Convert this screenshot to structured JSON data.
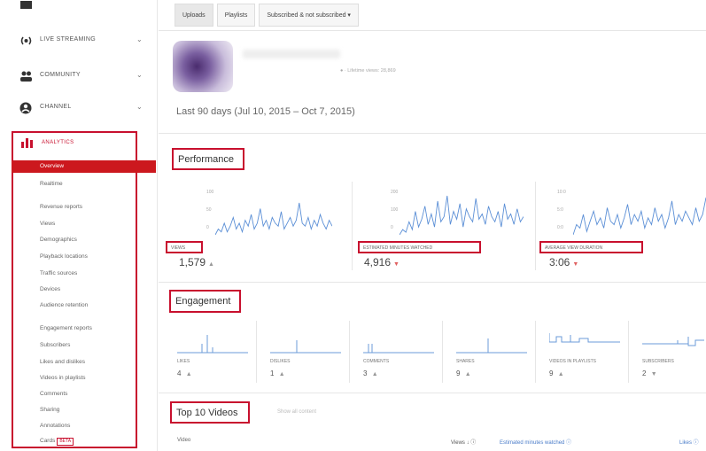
{
  "sidebar": {
    "sections": [
      {
        "label": "LIVE STREAMING",
        "icon": "live-stream-icon"
      },
      {
        "label": "COMMUNITY",
        "icon": "community-icon"
      },
      {
        "label": "CHANNEL",
        "icon": "channel-icon"
      }
    ],
    "analytics_label": "ANALYTICS",
    "analytics_icon": "bar-chart-icon",
    "overview": "Overview",
    "items": [
      "Realtime",
      "Revenue reports",
      "Views",
      "Demographics",
      "Playback locations",
      "Traffic sources",
      "Devices",
      "Audience retention",
      "Engagement reports",
      "Subscribers",
      "Likes and dislikes",
      "Videos in playlists",
      "Comments",
      "Sharing",
      "Annotations",
      "Cards"
    ],
    "beta_badge": "BETA",
    "accent": "#cc181e"
  },
  "tabs": [
    "Uploads",
    "Playlists",
    "Subscribed & not subscribed ▾"
  ],
  "channel": {
    "subtitle": "● · Lifetime views: 28,869"
  },
  "date_range": "Last 90 days (Jul 10, 2015 – Oct 7, 2015)",
  "performance": {
    "title": "Performance",
    "metrics": [
      {
        "label": "VIEWS",
        "value": "1,579",
        "trend": "▲",
        "trend_dir": "up",
        "axis": [
          "100",
          "50",
          "0"
        ],
        "series": [
          2,
          4,
          3,
          6,
          3,
          5,
          8,
          4,
          6,
          3,
          7,
          5,
          9,
          4,
          6,
          11,
          5,
          7,
          4,
          8,
          6,
          5,
          10,
          4,
          6,
          8,
          5,
          7,
          13,
          6,
          5,
          8,
          4,
          7,
          5,
          9,
          6,
          4,
          7,
          5
        ]
      },
      {
        "label": "ESTIMATED MINUTES WATCHED",
        "value": "4,916",
        "trend": "▼",
        "trend_dir": "down",
        "axis": [
          "200",
          "100",
          "0"
        ],
        "series": [
          3,
          5,
          4,
          8,
          5,
          12,
          6,
          9,
          14,
          7,
          11,
          6,
          16,
          8,
          10,
          18,
          7,
          12,
          9,
          15,
          6,
          13,
          10,
          8,
          17,
          9,
          11,
          7,
          14,
          10,
          8,
          12,
          6,
          15,
          9,
          11,
          7,
          13,
          8,
          10
        ]
      },
      {
        "label": "AVERAGE VIEW DURATION",
        "value": "3:06",
        "trend": "▼",
        "trend_dir": "down",
        "axis": [
          "10:0",
          "5:0",
          "0:0"
        ],
        "series": [
          3,
          6,
          5,
          9,
          4,
          7,
          10,
          6,
          8,
          5,
          11,
          7,
          6,
          9,
          5,
          8,
          12,
          6,
          9,
          7,
          10,
          5,
          8,
          6,
          11,
          7,
          9,
          5,
          8,
          13,
          6,
          9,
          7,
          10,
          8,
          6,
          11,
          7,
          9,
          14
        ]
      }
    ]
  },
  "engagement": {
    "title": "Engagement",
    "cards": [
      {
        "label": "LIKES",
        "value": "4",
        "trend": "▲"
      },
      {
        "label": "DISLIKES",
        "value": "1",
        "trend": "▲"
      },
      {
        "label": "COMMENTS",
        "value": "3",
        "trend": "▲"
      },
      {
        "label": "SHARES",
        "value": "9",
        "trend": "▲"
      },
      {
        "label": "VIDEOS IN PLAYLISTS",
        "value": "9",
        "trend": "▲"
      },
      {
        "label": "SUBSCRIBERS",
        "value": "2",
        "trend": "▼"
      }
    ]
  },
  "top_videos": {
    "title": "Top 10 Videos",
    "show_all": "Show all content",
    "col_video": "Video",
    "col_views": "Views ↓ ⓘ",
    "col_est": "Estimated minutes watched ⓘ",
    "col_likes": "Likes ⓘ"
  }
}
